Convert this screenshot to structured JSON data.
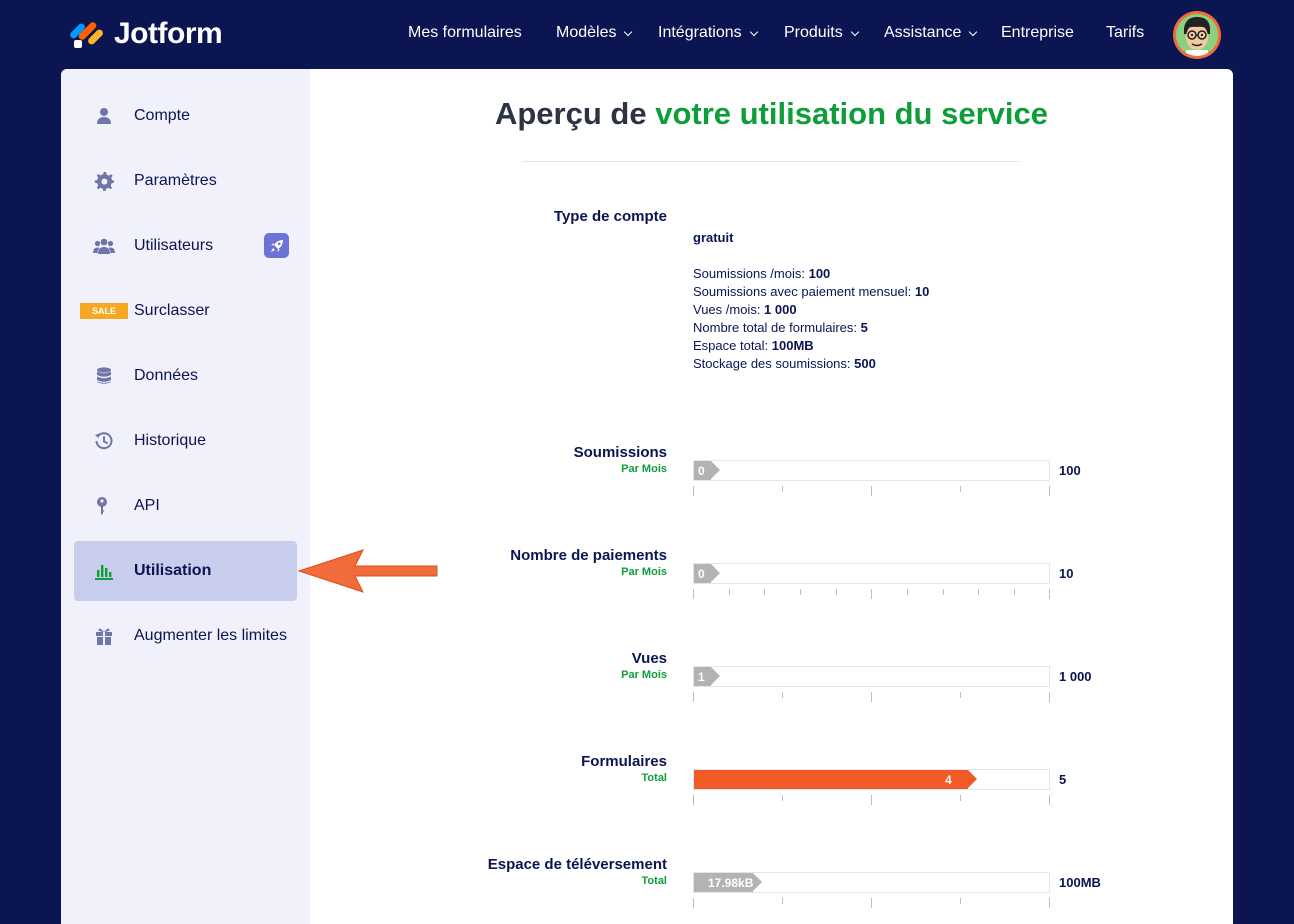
{
  "brand": {
    "name": "Jotform"
  },
  "nav": {
    "items": [
      {
        "label": "Mes formulaires",
        "dropdown": false
      },
      {
        "label": "Modèles",
        "dropdown": true
      },
      {
        "label": "Intégrations",
        "dropdown": true
      },
      {
        "label": "Produits",
        "dropdown": true
      },
      {
        "label": "Assistance",
        "dropdown": true
      },
      {
        "label": "Entreprise",
        "dropdown": false
      },
      {
        "label": "Tarifs",
        "dropdown": false
      }
    ]
  },
  "sidebar": {
    "items": [
      {
        "label": "Compte",
        "icon": "user-icon"
      },
      {
        "label": "Paramètres",
        "icon": "gear-icon"
      },
      {
        "label": "Utilisateurs",
        "icon": "users-icon",
        "badge": "rocket-icon"
      },
      {
        "label": "Surclasser",
        "icon": "sale-badge",
        "badge_text": "SALE"
      },
      {
        "label": "Données",
        "icon": "database-icon"
      },
      {
        "label": "Historique",
        "icon": "history-icon"
      },
      {
        "label": "API",
        "icon": "key-icon"
      },
      {
        "label": "Utilisation",
        "icon": "chart-icon",
        "active": true
      },
      {
        "label": "Augmenter les limites",
        "icon": "gift-icon"
      }
    ]
  },
  "main": {
    "title_plain": "Aperçu de ",
    "title_highlight": "votre utilisation du service",
    "account": {
      "label": "Type de compte",
      "type": "gratuit",
      "limits": [
        {
          "label": "Soumissions /mois: ",
          "value": "100"
        },
        {
          "label": "Soumissions avec paiement mensuel: ",
          "value": "10"
        },
        {
          "label": "Vues /mois: ",
          "value": "1 000"
        },
        {
          "label": "Nombre total de formulaires: ",
          "value": "5"
        },
        {
          "label": "Espace total: ",
          "value": "100MB"
        },
        {
          "label": "Stockage des soumissions: ",
          "value": "500"
        }
      ]
    },
    "usage": [
      {
        "label": "Soumissions",
        "period": "Par Mois",
        "value_label": "0",
        "max_label": "100",
        "fraction": 0,
        "color": "#b3b3b3"
      },
      {
        "label": "Nombre de paiements",
        "period": "Par Mois",
        "value_label": "0",
        "max_label": "10",
        "fraction": 0,
        "color": "#b3b3b3"
      },
      {
        "label": "Vues",
        "period": "Par Mois",
        "value_label": "1",
        "max_label": "1 000",
        "fraction": 0.001,
        "color": "#b3b3b3"
      },
      {
        "label": "Formulaires",
        "period": "Total",
        "value_label": "4",
        "max_label": "5",
        "fraction": 0.8,
        "color": "#f15a24"
      },
      {
        "label": "Espace de téléversement",
        "period": "Total",
        "value_label": "17.98kB",
        "max_label": "100MB",
        "fraction": 0.0002,
        "color": "#b3b3b3"
      }
    ]
  },
  "colors": {
    "navy": "#0a1551",
    "green": "#0f9d3a",
    "orange": "#f15a24",
    "annotation": "#f26b3a"
  }
}
